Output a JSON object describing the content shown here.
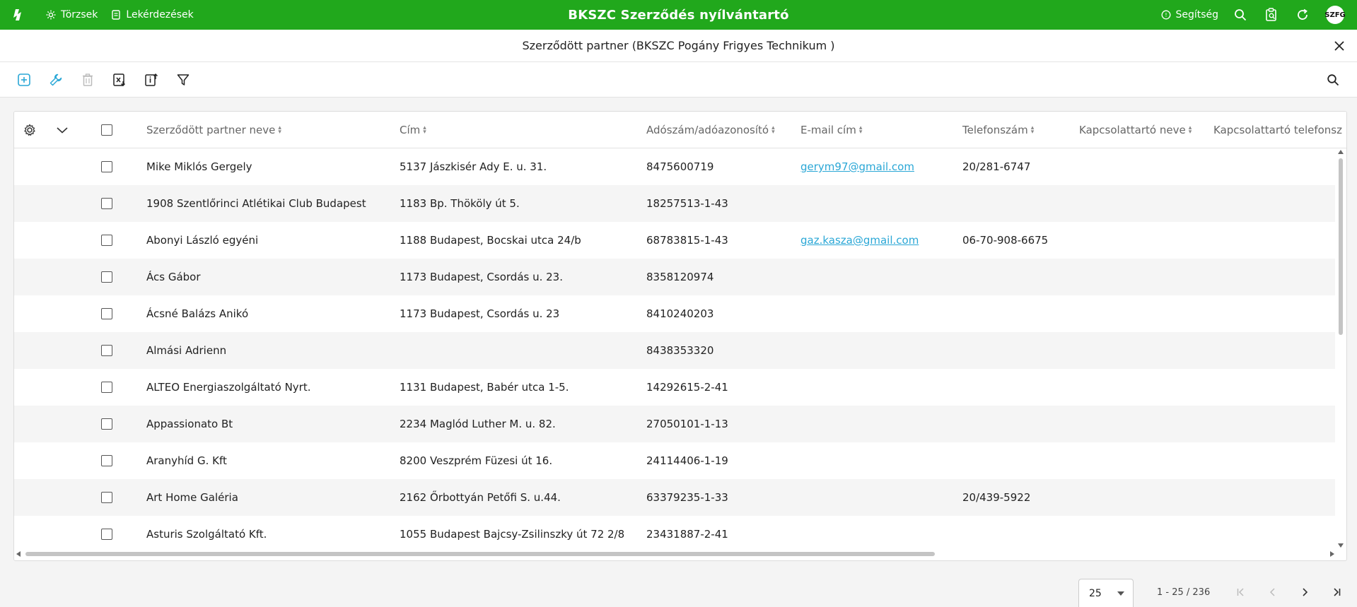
{
  "app": {
    "title": "BKSZC Szerződés nyílvántartó",
    "nav": [
      {
        "label": "Törzsek",
        "icon": "gear-icon"
      },
      {
        "label": "Lekérdezések",
        "icon": "document-icon"
      }
    ],
    "help_label": "Segítség",
    "avatar_text": "SZFG"
  },
  "dialog": {
    "title": "Szerződött partner (BKSZC Pogány Frigyes Technikum )"
  },
  "toolbar": {
    "tools": [
      "add-icon",
      "wrench-icon",
      "trash-icon",
      "excel-export-icon",
      "import-icon",
      "filter-icon"
    ]
  },
  "grid": {
    "columns": [
      "Szerződött partner neve",
      "Cím",
      "Adószám/adóazonosító",
      "E-mail cím",
      "Telefonszám",
      "Kapcsolattartó neve",
      "Kapcsolattartó telefonsz"
    ],
    "rows": [
      {
        "name": "Mike Miklós Gergely",
        "address": "5137 Jászkisér Ady E. u. 31.",
        "tax": "8475600719",
        "email": "gerym97@gmail.com",
        "phone": "20/281-6747"
      },
      {
        "name": "1908 Szentlőrinci Atlétikai Club Budapest",
        "address": "1183 Bp. Thököly út 5.",
        "tax": "18257513-1-43",
        "email": "",
        "phone": ""
      },
      {
        "name": "Abonyi László egyéni",
        "address": "1188 Budapest, Bocskai utca 24/b",
        "tax": "68783815-1-43",
        "email": "gaz.kasza@gmail.com",
        "phone": "06-70-908-6675"
      },
      {
        "name": "Ács Gábor",
        "address": "1173 Budapest, Csordás u. 23.",
        "tax": "8358120974",
        "email": "",
        "phone": ""
      },
      {
        "name": "Ácsné Balázs Anikó",
        "address": "1173 Budapest, Csordás u. 23",
        "tax": "8410240203",
        "email": "",
        "phone": ""
      },
      {
        "name": "Almási Adrienn",
        "address": "",
        "tax": "8438353320",
        "email": "",
        "phone": ""
      },
      {
        "name": "ALTEO Energiaszolgáltató Nyrt.",
        "address": "1131 Budapest, Babér utca 1-5.",
        "tax": "14292615-2-41",
        "email": "",
        "phone": ""
      },
      {
        "name": "Appassionato Bt",
        "address": "2234 Maglód Luther M. u. 82.",
        "tax": "27050101-1-13",
        "email": "",
        "phone": ""
      },
      {
        "name": "Aranyhíd G. Kft",
        "address": "8200 Veszprém Füzesi út 16.",
        "tax": "24114406-1-19",
        "email": "",
        "phone": ""
      },
      {
        "name": "Art Home Galéria",
        "address": "2162 Őrbottyán Petőfi S. u.44.",
        "tax": "63379235-1-33",
        "email": "",
        "phone": "20/439-5922"
      },
      {
        "name": "Asturis Szolgáltató Kft.",
        "address": "1055 Budapest Bajcsy-Zsilinszky út 72 2/8",
        "tax": "23431887-2-41",
        "email": "",
        "phone": ""
      }
    ]
  },
  "paginator": {
    "page_size": "25",
    "range": "1 - 25 / 236"
  },
  "colors": {
    "brand": "#21a81c",
    "add_accent": "#2aa7d6",
    "link": "#2aa7d6"
  }
}
